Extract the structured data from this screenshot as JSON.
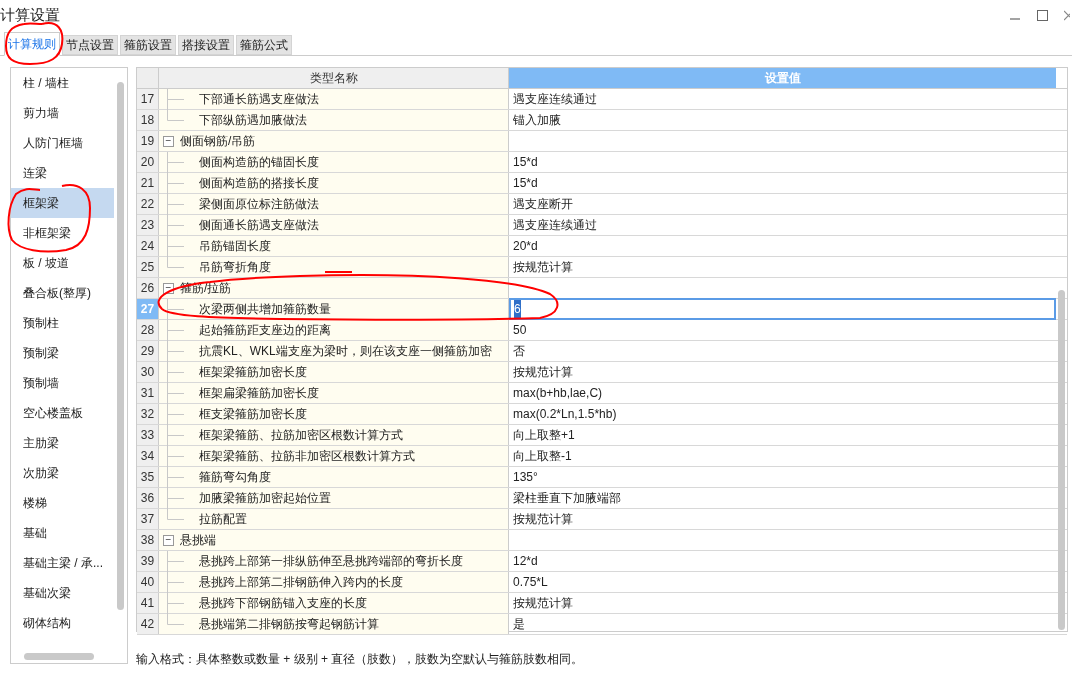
{
  "window": {
    "title": "计算设置"
  },
  "tabs": [
    {
      "label": "计算规则",
      "selected": true
    },
    {
      "label": "节点设置",
      "selected": false
    },
    {
      "label": "箍筋设置",
      "selected": false
    },
    {
      "label": "搭接设置",
      "selected": false
    },
    {
      "label": "箍筋公式",
      "selected": false
    }
  ],
  "sidebar": {
    "items": [
      {
        "label": "柱 / 墙柱",
        "selected": false
      },
      {
        "label": "剪力墙",
        "selected": false
      },
      {
        "label": "人防门框墙",
        "selected": false
      },
      {
        "label": "连梁",
        "selected": false
      },
      {
        "label": "框架梁",
        "selected": true
      },
      {
        "label": "非框架梁",
        "selected": false
      },
      {
        "label": "板 / 坡道",
        "selected": false
      },
      {
        "label": "叠合板(整厚)",
        "selected": false
      },
      {
        "label": "预制柱",
        "selected": false
      },
      {
        "label": "预制梁",
        "selected": false
      },
      {
        "label": "预制墙",
        "selected": false
      },
      {
        "label": "空心楼盖板",
        "selected": false
      },
      {
        "label": "主肋梁",
        "selected": false
      },
      {
        "label": "次肋梁",
        "selected": false
      },
      {
        "label": "楼梯",
        "selected": false
      },
      {
        "label": "基础",
        "selected": false
      },
      {
        "label": "基础主梁 / 承...",
        "selected": false
      },
      {
        "label": "基础次梁",
        "selected": false
      },
      {
        "label": "砌体结构",
        "selected": false
      }
    ]
  },
  "table": {
    "columns": [
      "类型名称",
      "设置值"
    ],
    "rows": [
      {
        "kind": "item",
        "number": "17",
        "name": "下部通长筋遇支座做法",
        "value": "遇支座连续通过",
        "selected": false
      },
      {
        "kind": "item",
        "number": "18",
        "name": "下部纵筋遇加腋做法",
        "value": "锚入加腋",
        "selected": false
      },
      {
        "kind": "group",
        "number": "19",
        "name": "侧面钢筋/吊筋",
        "expander": "−",
        "selected": false
      },
      {
        "kind": "item",
        "number": "20",
        "name": "侧面构造筋的锚固长度",
        "value": "15*d",
        "selected": false
      },
      {
        "kind": "item",
        "number": "21",
        "name": "侧面构造筋的搭接长度",
        "value": "15*d",
        "selected": false
      },
      {
        "kind": "item",
        "number": "22",
        "name": "梁侧面原位标注筋做法",
        "value": "遇支座断开",
        "selected": false
      },
      {
        "kind": "item",
        "number": "23",
        "name": "侧面通长筋遇支座做法",
        "value": "遇支座连续通过",
        "selected": false
      },
      {
        "kind": "item",
        "number": "24",
        "name": "吊筋锚固长度",
        "value": "20*d",
        "selected": false
      },
      {
        "kind": "item",
        "number": "25",
        "name": "吊筋弯折角度",
        "value": "按规范计算",
        "selected": false
      },
      {
        "kind": "group",
        "number": "26",
        "name": "箍筋/拉筋",
        "expander": "−",
        "selected": false
      },
      {
        "kind": "item",
        "number": "27",
        "name": "次梁两侧共增加箍筋数量",
        "value": "6",
        "selected": true
      },
      {
        "kind": "item",
        "number": "28",
        "name": "起始箍筋距支座边的距离",
        "value": "50",
        "selected": false
      },
      {
        "kind": "item",
        "number": "29",
        "name": "抗震KL、WKL端支座为梁时，则在该支座一侧箍筋加密",
        "value": "否",
        "selected": false
      },
      {
        "kind": "item",
        "number": "30",
        "name": "框架梁箍筋加密长度",
        "value": "按规范计算",
        "selected": false
      },
      {
        "kind": "item",
        "number": "31",
        "name": "框架扁梁箍筋加密长度",
        "value": "max(b+hb,lae,C)",
        "selected": false
      },
      {
        "kind": "item",
        "number": "32",
        "name": "框支梁箍筋加密长度",
        "value": "max(0.2*Ln,1.5*hb)",
        "selected": false
      },
      {
        "kind": "item",
        "number": "33",
        "name": "框架梁箍筋、拉筋加密区根数计算方式",
        "value": "向上取整+1",
        "selected": false
      },
      {
        "kind": "item",
        "number": "34",
        "name": "框架梁箍筋、拉筋非加密区根数计算方式",
        "value": "向上取整-1",
        "selected": false
      },
      {
        "kind": "item",
        "number": "35",
        "name": "箍筋弯勾角度",
        "value": "135°",
        "selected": false
      },
      {
        "kind": "item",
        "number": "36",
        "name": "加腋梁箍筋加密起始位置",
        "value": "梁柱垂直下加腋端部",
        "selected": false
      },
      {
        "kind": "item",
        "number": "37",
        "name": "拉筋配置",
        "value": "按规范计算",
        "selected": false
      },
      {
        "kind": "group",
        "number": "38",
        "name": "悬挑端",
        "expander": "−",
        "selected": false
      },
      {
        "kind": "item",
        "number": "39",
        "name": "悬挑跨上部第一排纵筋伸至悬挑跨端部的弯折长度",
        "value": "12*d",
        "selected": false
      },
      {
        "kind": "item",
        "number": "40",
        "name": "悬挑跨上部第二排钢筋伸入跨内的长度",
        "value": "0.75*L",
        "selected": false
      },
      {
        "kind": "item",
        "number": "41",
        "name": "悬挑跨下部钢筋锚入支座的长度",
        "value": "按规范计算",
        "selected": false
      },
      {
        "kind": "item",
        "number": "42",
        "name": "悬挑端第二排钢筋按弯起钢筋计算",
        "value": "是",
        "selected": false
      }
    ]
  },
  "hint": "输入格式：具体整数或数量 + 级别 + 直径（肢数），肢数为空默认与箍筋肢数相同。"
}
